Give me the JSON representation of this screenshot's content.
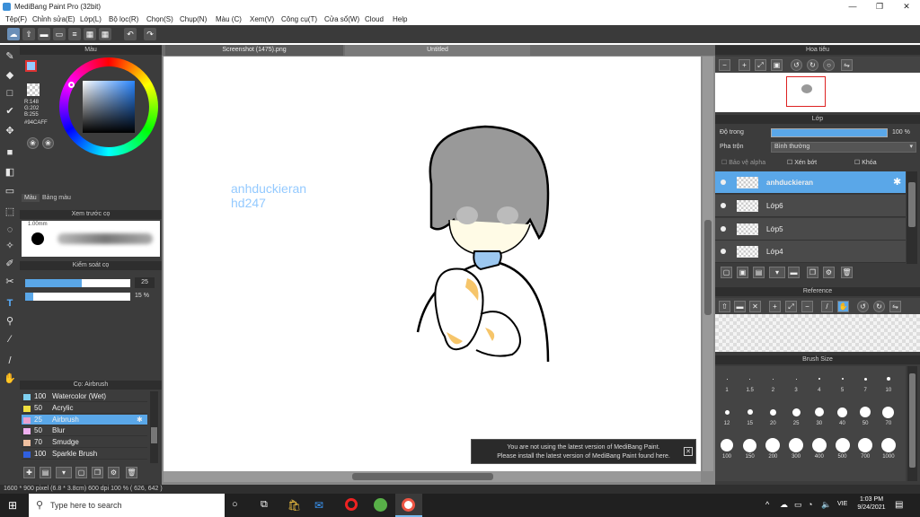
{
  "window": {
    "title": "MediBang Paint Pro (32bit)"
  },
  "menu": [
    "Tệp(F)",
    "Chỉnh sửa(E)",
    "Lớp(L)",
    "Bộ lọc(R)",
    "Chọn(S)",
    "Chụp(N)",
    "Màu (C)",
    "Xem(V)",
    "Công cụ(T)",
    "Cửa sổ(W)",
    "Cloud",
    "Help"
  ],
  "color_panel": {
    "title": "Màu",
    "rgb_r": "R:148",
    "rgb_g": "G:202",
    "rgb_b": "B:255",
    "hex": "#94CAFF",
    "tab_color": "Màu",
    "tab_palette": "Bảng màu",
    "main_color": "#94caff"
  },
  "brush_preview": {
    "title": "Xem trước cọ",
    "size": "1.00mm"
  },
  "brush_control": {
    "title": "Kiểm soát cọ",
    "size_value": "25",
    "opacity_value": "15 %",
    "size_fill": 0.54,
    "opacity_fill": 0.08
  },
  "brush_list": {
    "title": "Cọ: Airbrush",
    "items": [
      {
        "size": "100",
        "name": "Watercolor (Wet)",
        "color": "#7fd0f0"
      },
      {
        "size": "50",
        "name": "Acrylic",
        "color": "#f0e040"
      },
      {
        "size": "25",
        "name": "Airbrush",
        "color": "#e8a0d0"
      },
      {
        "size": "50",
        "name": "Blur",
        "color": "#f0b0f0"
      },
      {
        "size": "70",
        "name": "Smudge",
        "color": "#f0c0a0"
      },
      {
        "size": "100",
        "name": "Sparkle Brush",
        "color": "#3060e0"
      }
    ]
  },
  "tabs": [
    "Screenshot (1475).png",
    "Untitled"
  ],
  "canvas": {
    "text_line1": "anhduckieran",
    "text_line2": "hd247",
    "text_color": "#94caff"
  },
  "notification": {
    "line1": "You are not using the latest version of MediBang Paint.",
    "line2": "Please install the latest version of MediBang Paint found here.",
    "close": "✕"
  },
  "navigator": {
    "title": "Hoa tiêu"
  },
  "layer_panel": {
    "title": "Lớp",
    "opacity_label": "Độ trong",
    "opacity_value": "100 %",
    "blend_label": "Pha trộn",
    "blend_value": "Bình thường",
    "protect_alpha": "Bảo vệ alpha",
    "clipping": "Xén bớt",
    "lock": "Khóa",
    "layers": [
      "anhduckieran",
      "Lớp6",
      "Lớp5",
      "Lớp4"
    ]
  },
  "reference_panel": {
    "title": "Reference"
  },
  "brush_size_panel": {
    "title": "Brush Size",
    "row1": [
      "1",
      "1.5",
      "2",
      "3",
      "4",
      "5",
      "7",
      "10"
    ],
    "row2": [
      "12",
      "15",
      "20",
      "25",
      "30",
      "40",
      "50",
      "70"
    ],
    "row3": [
      "100",
      "150",
      "200",
      "300",
      "400",
      "500",
      "700",
      "1000"
    ]
  },
  "status": {
    "text": "1600 * 900 pixel   (6.8 * 3.8cm)   600 dpi   100 %   ( 626, 642 )"
  },
  "taskbar": {
    "search_placeholder": "Type here to search",
    "time": "1:03 PM",
    "date": "9/24/2021",
    "lang": "VIE"
  }
}
